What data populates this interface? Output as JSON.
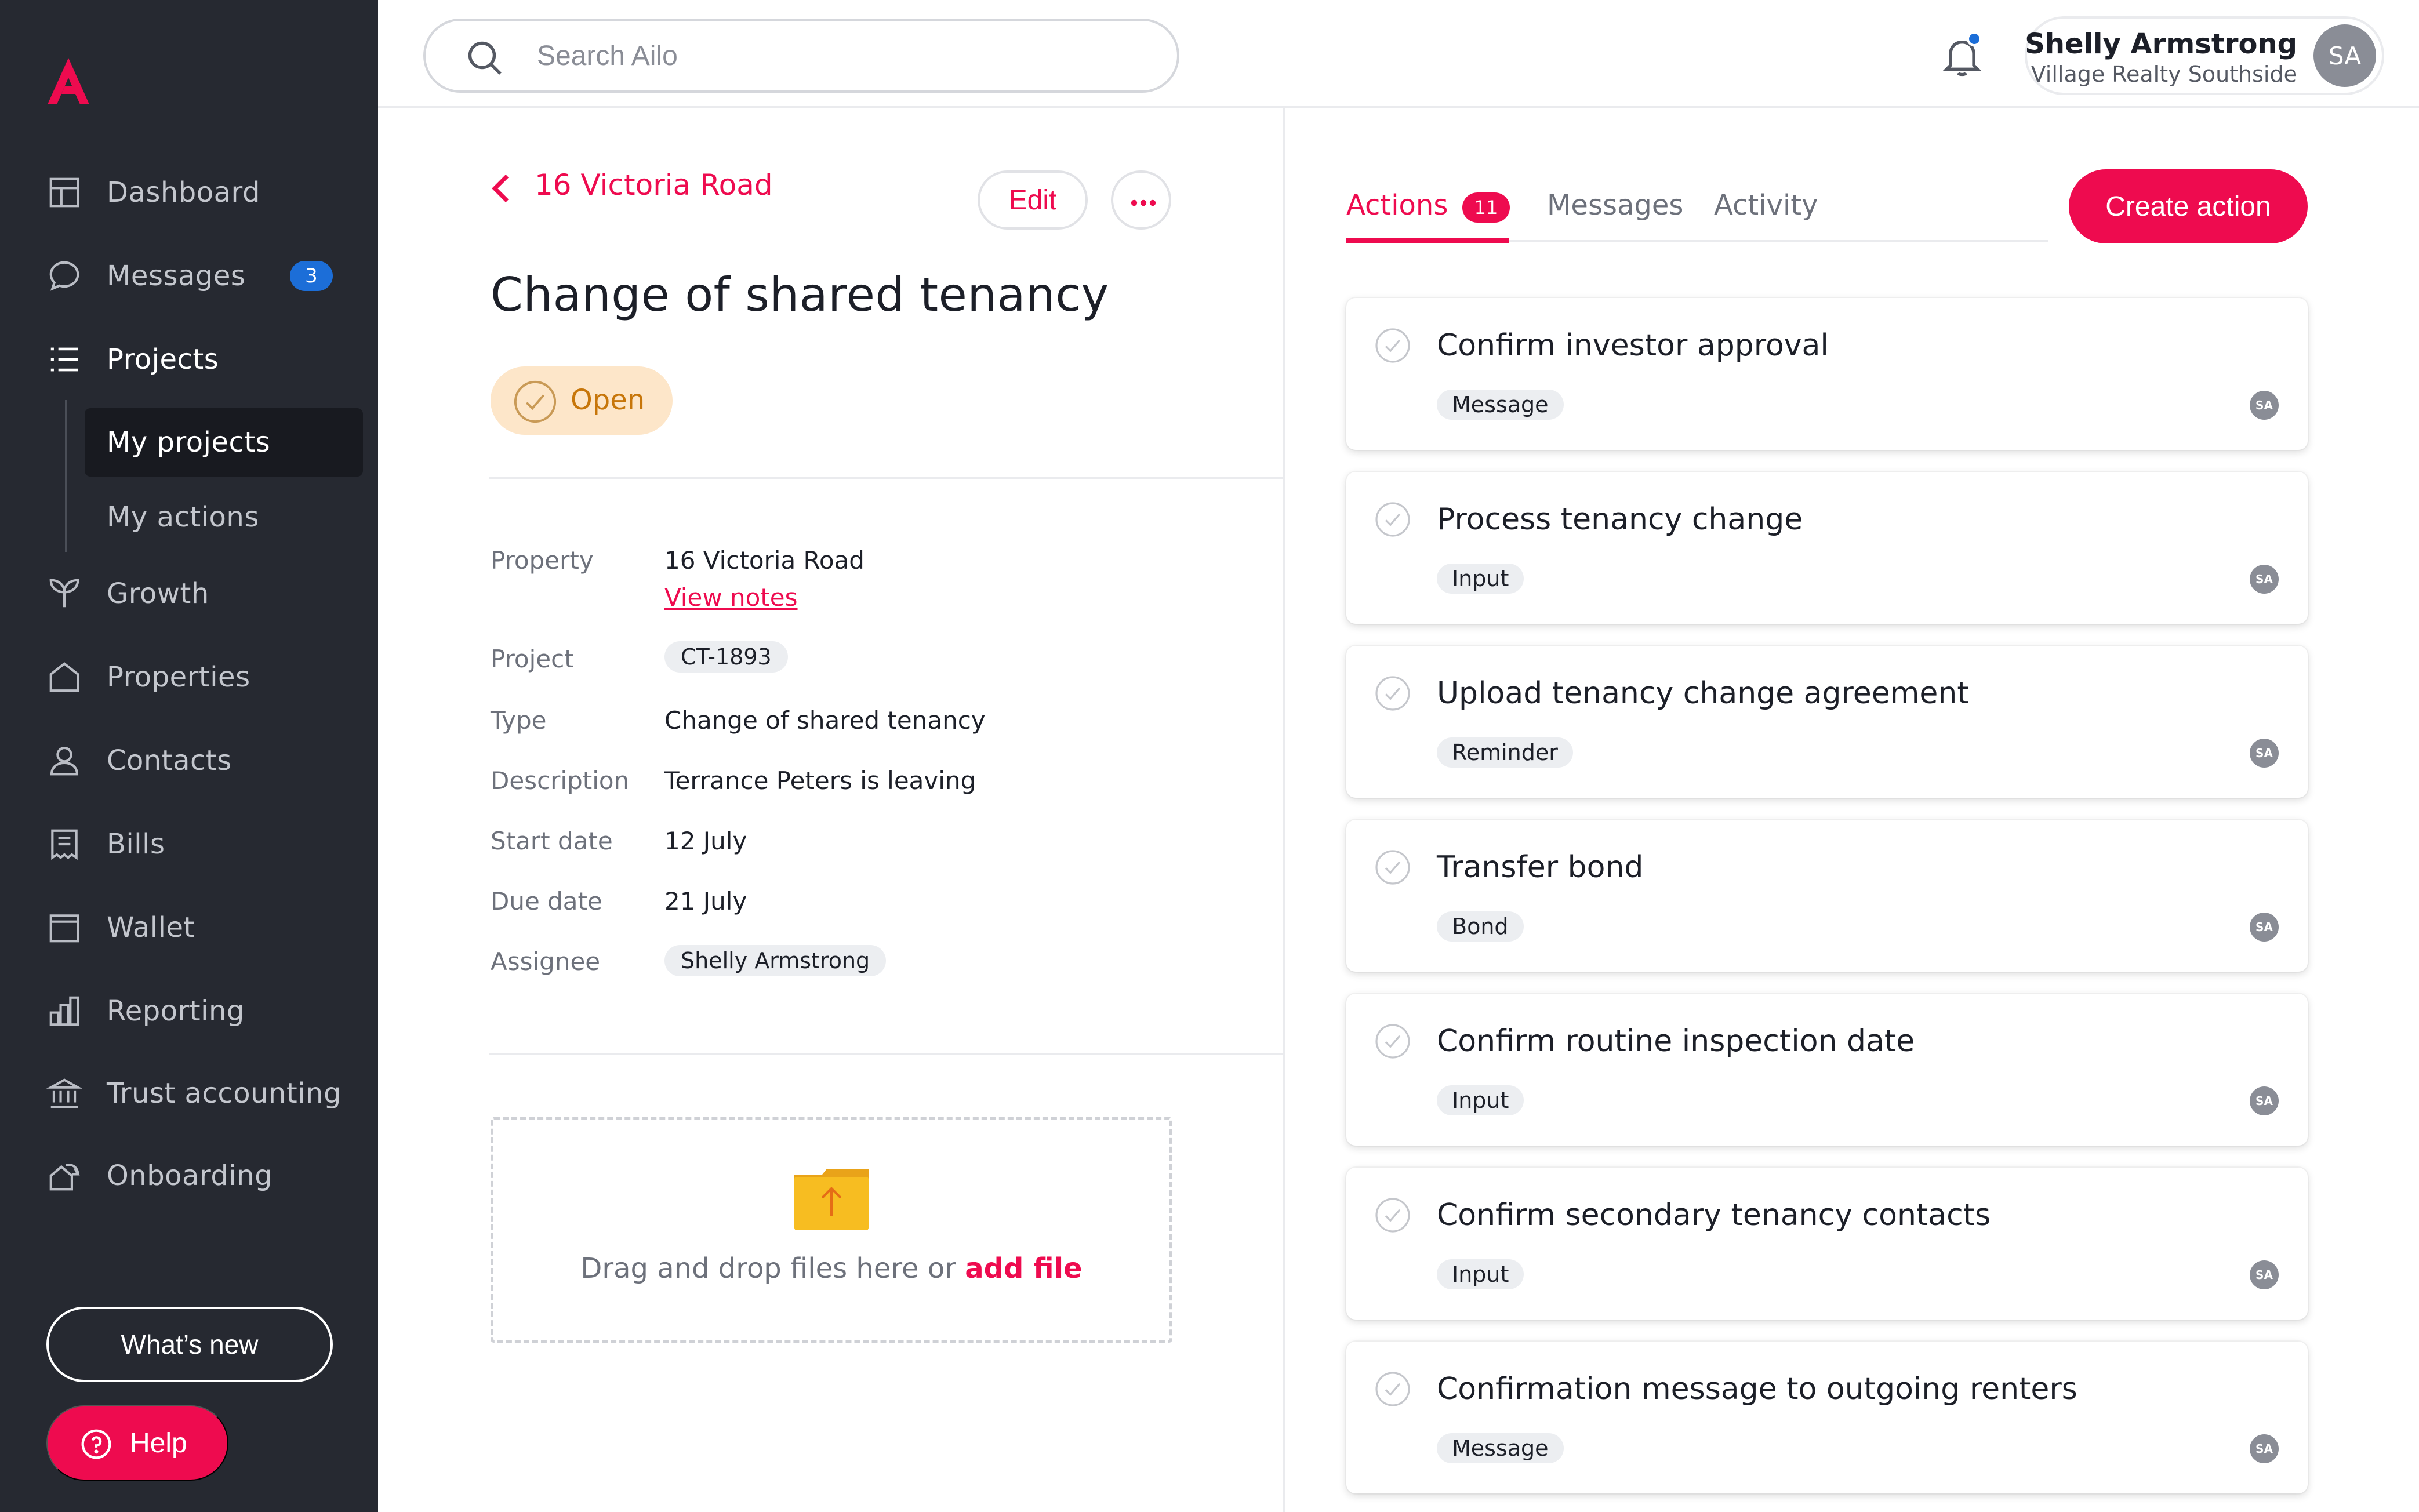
{
  "app": {
    "brand_color": "#ee0b4f",
    "sidebar_bg": "#262931",
    "accent_blue": "#1c6ed8"
  },
  "sidebar": {
    "logo_icon": "ailo-logo-icon",
    "items": [
      {
        "label": "Dashboard",
        "icon": "dashboard-icon"
      },
      {
        "label": "Messages",
        "icon": "chat-bubble-icon",
        "badge": "3"
      },
      {
        "label": "Projects",
        "icon": "list-icon",
        "active": true
      },
      {
        "label": "Growth",
        "icon": "sprout-icon"
      },
      {
        "label": "Properties",
        "icon": "house-icon"
      },
      {
        "label": "Contacts",
        "icon": "person-icon"
      },
      {
        "label": "Bills",
        "icon": "receipt-icon"
      },
      {
        "label": "Wallet",
        "icon": "wallet-icon"
      },
      {
        "label": "Reporting",
        "icon": "bar-chart-icon"
      },
      {
        "label": "Trust accounting",
        "icon": "bank-icon"
      },
      {
        "label": "Onboarding",
        "icon": "onboarding-icon"
      }
    ],
    "subitems": [
      {
        "label": "My projects",
        "active": true
      },
      {
        "label": "My actions"
      }
    ],
    "whats_new": "What’s new",
    "help": "Help"
  },
  "topbar": {
    "search_placeholder": "Search Ailo",
    "user": {
      "name": "Shelly Armstrong",
      "agency": "Village Realty Southside",
      "initials": "SA"
    }
  },
  "project": {
    "breadcrumb": "16 Victoria Road",
    "edit_label": "Edit",
    "title": "Change of shared tenancy",
    "status": "Open",
    "details": [
      {
        "label": "Property",
        "value": "16 Victoria Road",
        "link": "View notes"
      },
      {
        "label": "Project",
        "value": "CT-1893",
        "chip": true
      },
      {
        "label": "Type",
        "value": "Change of shared tenancy"
      },
      {
        "label": "Description",
        "value": "Terrance Peters is leaving"
      },
      {
        "label": "Start date",
        "value": "12 July"
      },
      {
        "label": "Due date",
        "value": "21 July"
      },
      {
        "label": "Assignee",
        "value": "Shelly Armstrong",
        "chip": true
      }
    ],
    "dropzone": {
      "text": "Drag and drop files here or",
      "link": "add file"
    }
  },
  "panel": {
    "tabs": [
      {
        "label": "Actions",
        "badge": "11",
        "active": true
      },
      {
        "label": "Messages"
      },
      {
        "label": "Activity"
      }
    ],
    "create_action": "Create action",
    "actions": [
      {
        "title": "Confirm investor approval",
        "type": "Message",
        "assignee": "SA"
      },
      {
        "title": "Process tenancy change",
        "type": "Input",
        "assignee": "SA"
      },
      {
        "title": "Upload tenancy change agreement",
        "type": "Reminder",
        "assignee": "SA"
      },
      {
        "title": "Transfer bond",
        "type": "Bond",
        "assignee": "SA"
      },
      {
        "title": "Confirm routine inspection date",
        "type": "Input",
        "assignee": "SA"
      },
      {
        "title": "Confirm secondary tenancy contacts",
        "type": "Input",
        "assignee": "SA"
      },
      {
        "title": "Confirmation message to outgoing renters",
        "type": "Message",
        "assignee": "SA"
      }
    ]
  }
}
